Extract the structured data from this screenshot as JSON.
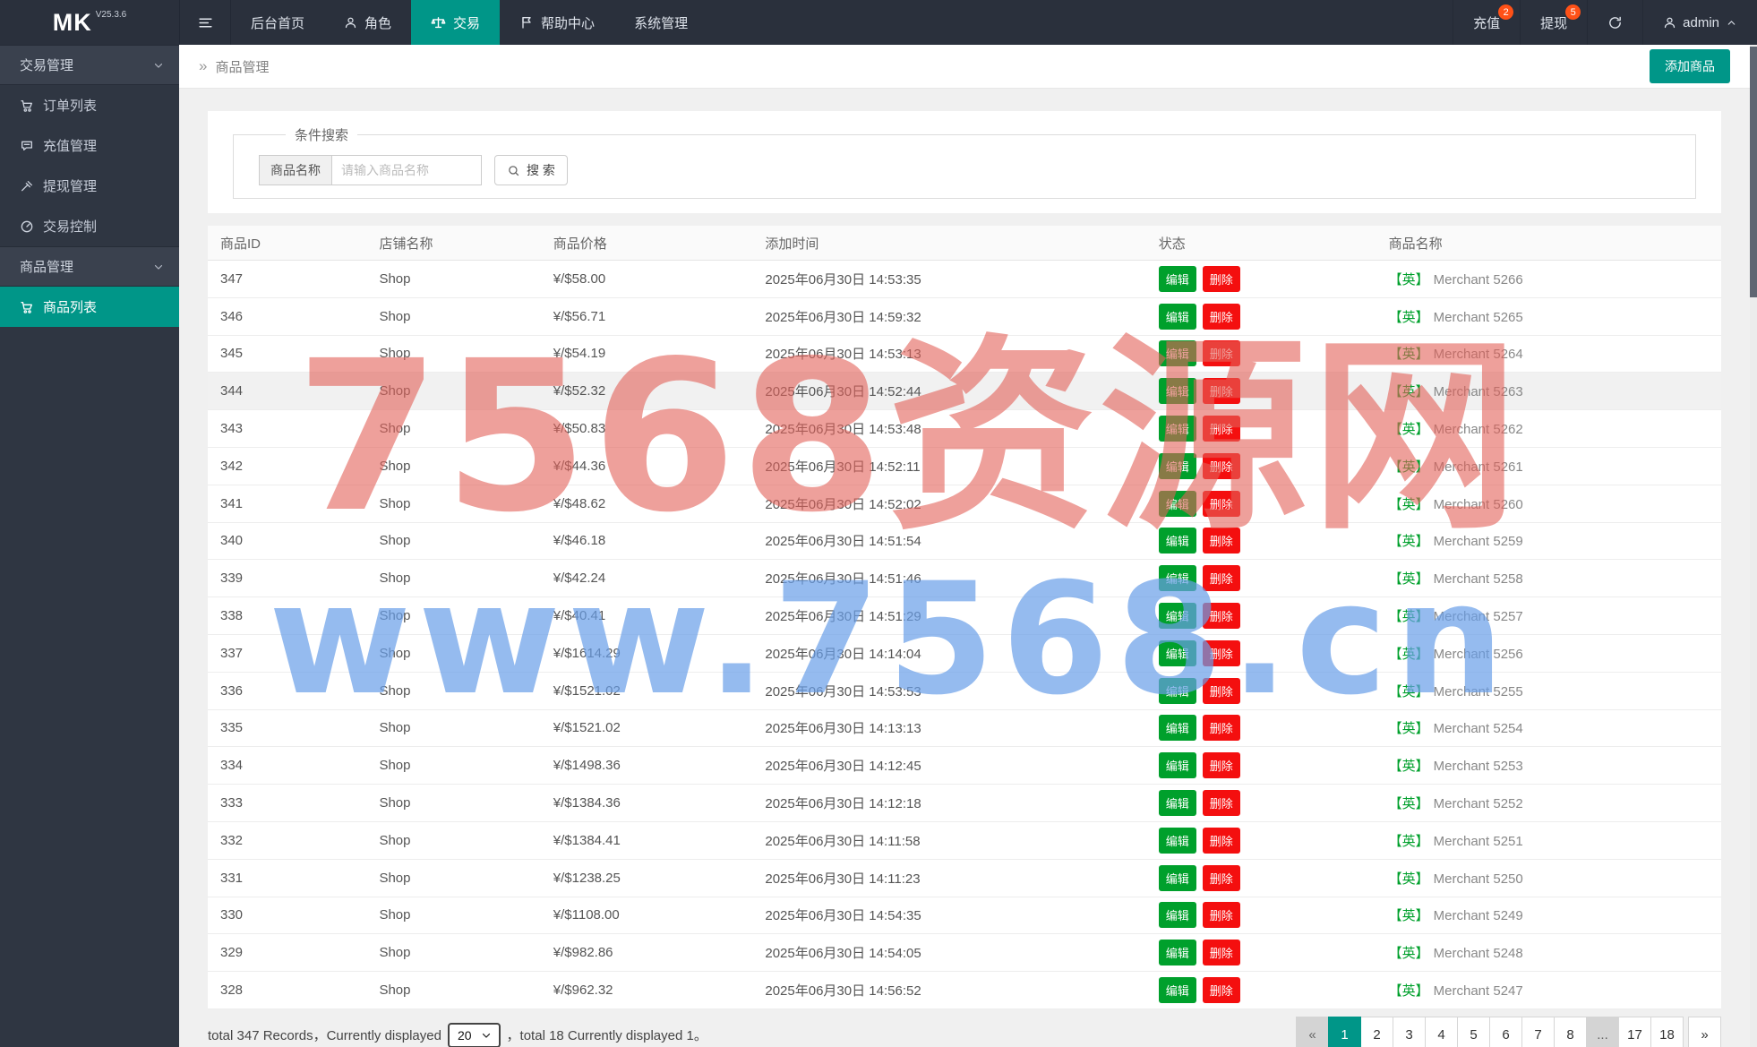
{
  "navbar": {
    "logo": "MK",
    "version": "V25.3.6",
    "menu": [
      {
        "id": "dashboard",
        "label": "后台首页",
        "icon": null,
        "active": false
      },
      {
        "id": "roles",
        "label": "角色",
        "icon": "person-icon",
        "active": false
      },
      {
        "id": "trade",
        "label": "交易",
        "icon": "scales-icon",
        "active": true
      },
      {
        "id": "help-center",
        "label": "帮助中心",
        "icon": "flag-icon",
        "active": false
      },
      {
        "id": "system",
        "label": "系统管理",
        "icon": null,
        "active": false
      }
    ],
    "recharge": {
      "label": "充值",
      "badge": "2"
    },
    "withdraw": {
      "label": "提现",
      "badge": "5"
    },
    "user": {
      "name": "admin"
    }
  },
  "sidebar": {
    "items": [
      {
        "id": "trade-mgmt",
        "label": "交易管理",
        "type": "group",
        "icon": null,
        "active": false
      },
      {
        "id": "order-list",
        "label": "订单列表",
        "type": "item",
        "icon": "cart-icon",
        "active": false
      },
      {
        "id": "recharge-mgmt",
        "label": "充值管理",
        "type": "item",
        "icon": "comment-icon",
        "active": false
      },
      {
        "id": "withdraw-mgmt",
        "label": "提现管理",
        "type": "item",
        "icon": "gavel-icon",
        "active": false
      },
      {
        "id": "trade-control",
        "label": "交易控制",
        "type": "item",
        "icon": "gauge-icon",
        "active": false
      },
      {
        "id": "product-mgmt",
        "label": "商品管理",
        "type": "group",
        "icon": null,
        "active": false
      },
      {
        "id": "product-list",
        "label": "商品列表",
        "type": "item",
        "icon": "cart-icon",
        "active": true
      }
    ]
  },
  "page": {
    "breadcrumb_icon": "»",
    "breadcrumb": "商品管理",
    "add_button": "添加商品"
  },
  "search": {
    "legend": "条件搜索",
    "field_label": "商品名称",
    "placeholder": "请输入商品名称",
    "button_label": "搜 索"
  },
  "table": {
    "columns": [
      "商品ID",
      "店铺名称",
      "商品价格",
      "添加时间",
      "状态",
      "商品名称"
    ],
    "edit_label": "编辑",
    "delete_label": "删除",
    "rows": [
      {
        "id": "347",
        "shop": "Shop",
        "price": "¥/$58.00",
        "time": "2025年06月30日 14:53:35",
        "tag": "【英】",
        "name": "Merchant 5266",
        "highlight": false
      },
      {
        "id": "346",
        "shop": "Shop",
        "price": "¥/$56.71",
        "time": "2025年06月30日 14:59:32",
        "tag": "【英】",
        "name": "Merchant 5265",
        "highlight": false
      },
      {
        "id": "345",
        "shop": "Shop",
        "price": "¥/$54.19",
        "time": "2025年06月30日 14:53:13",
        "tag": "【英】",
        "name": "Merchant 5264",
        "highlight": false
      },
      {
        "id": "344",
        "shop": "Shop",
        "price": "¥/$52.32",
        "time": "2025年06月30日 14:52:44",
        "tag": "【英】",
        "name": "Merchant 5263",
        "highlight": true
      },
      {
        "id": "343",
        "shop": "Shop",
        "price": "¥/$50.83",
        "time": "2025年06月30日 14:53:48",
        "tag": "【英】",
        "name": "Merchant 5262",
        "highlight": false
      },
      {
        "id": "342",
        "shop": "Shop",
        "price": "¥/$44.36",
        "time": "2025年06月30日 14:52:11",
        "tag": "【英】",
        "name": "Merchant 5261",
        "highlight": false
      },
      {
        "id": "341",
        "shop": "Shop",
        "price": "¥/$48.62",
        "time": "2025年06月30日 14:52:02",
        "tag": "【英】",
        "name": "Merchant 5260",
        "highlight": false
      },
      {
        "id": "340",
        "shop": "Shop",
        "price": "¥/$46.18",
        "time": "2025年06月30日 14:51:54",
        "tag": "【英】",
        "name": "Merchant 5259",
        "highlight": false
      },
      {
        "id": "339",
        "shop": "Shop",
        "price": "¥/$42.24",
        "time": "2025年06月30日 14:51:46",
        "tag": "【英】",
        "name": "Merchant 5258",
        "highlight": false
      },
      {
        "id": "338",
        "shop": "Shop",
        "price": "¥/$40.41",
        "time": "2025年06月30日 14:51:29",
        "tag": "【英】",
        "name": "Merchant 5257",
        "highlight": false
      },
      {
        "id": "337",
        "shop": "Shop",
        "price": "¥/$1614.29",
        "time": "2025年06月30日 14:14:04",
        "tag": "【英】",
        "name": "Merchant 5256",
        "highlight": false
      },
      {
        "id": "336",
        "shop": "Shop",
        "price": "¥/$1521.02",
        "time": "2025年06月30日 14:53:53",
        "tag": "【英】",
        "name": "Merchant 5255",
        "highlight": false
      },
      {
        "id": "335",
        "shop": "Shop",
        "price": "¥/$1521.02",
        "time": "2025年06月30日 14:13:13",
        "tag": "【英】",
        "name": "Merchant 5254",
        "highlight": false
      },
      {
        "id": "334",
        "shop": "Shop",
        "price": "¥/$1498.36",
        "time": "2025年06月30日 14:12:45",
        "tag": "【英】",
        "name": "Merchant 5253",
        "highlight": false
      },
      {
        "id": "333",
        "shop": "Shop",
        "price": "¥/$1384.36",
        "time": "2025年06月30日 14:12:18",
        "tag": "【英】",
        "name": "Merchant 5252",
        "highlight": false
      },
      {
        "id": "332",
        "shop": "Shop",
        "price": "¥/$1384.41",
        "time": "2025年06月30日 14:11:58",
        "tag": "【英】",
        "name": "Merchant 5251",
        "highlight": false
      },
      {
        "id": "331",
        "shop": "Shop",
        "price": "¥/$1238.25",
        "time": "2025年06月30日 14:11:23",
        "tag": "【英】",
        "name": "Merchant 5250",
        "highlight": false
      },
      {
        "id": "330",
        "shop": "Shop",
        "price": "¥/$1108.00",
        "time": "2025年06月30日 14:54:35",
        "tag": "【英】",
        "name": "Merchant 5249",
        "highlight": false
      },
      {
        "id": "329",
        "shop": "Shop",
        "price": "¥/$982.86",
        "time": "2025年06月30日 14:54:05",
        "tag": "【英】",
        "name": "Merchant 5248",
        "highlight": false
      },
      {
        "id": "328",
        "shop": "Shop",
        "price": "¥/$962.32",
        "time": "2025年06月30日 14:56:52",
        "tag": "【英】",
        "name": "Merchant 5247",
        "highlight": false
      }
    ]
  },
  "pagination": {
    "summary_prefix": "total 347 Records，Currently displayed",
    "page_size": "20",
    "summary_suffix": "，total 18 Currently displayed 1。",
    "pages": [
      {
        "label": "«",
        "state": "disabled"
      },
      {
        "label": "1",
        "state": "active"
      },
      {
        "label": "2",
        "state": "normal"
      },
      {
        "label": "3",
        "state": "normal"
      },
      {
        "label": "4",
        "state": "normal"
      },
      {
        "label": "5",
        "state": "normal"
      },
      {
        "label": "6",
        "state": "normal"
      },
      {
        "label": "7",
        "state": "normal"
      },
      {
        "label": "8",
        "state": "normal"
      },
      {
        "label": "...",
        "state": "disabled"
      },
      {
        "label": "17",
        "state": "normal"
      },
      {
        "label": "18",
        "state": "normal"
      },
      {
        "label": "»",
        "state": "normal"
      }
    ]
  },
  "watermark": {
    "line1": "7568资源网",
    "line2": "www.7568.cn"
  },
  "colors": {
    "accent_teal": "#009688",
    "badge_orange": "#ff5117",
    "edit_green": "#00a02c",
    "delete_red": "#f40f0f",
    "navbar_bg": "#2a303c",
    "sidebar_bg": "#2f3642"
  }
}
